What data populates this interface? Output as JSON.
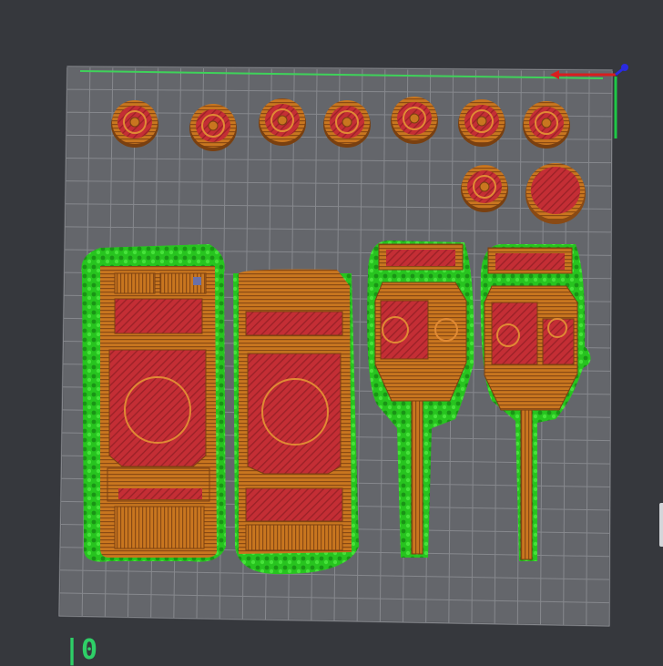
{
  "viewport": {
    "background_color": "#36383d",
    "plate_color": "#64666b",
    "grid_color": "#8d8f94",
    "colors": {
      "perimeter": "#c9761f",
      "perimeter_dark": "#7a4010",
      "infill": "#c42e35",
      "support": "#27c41f",
      "axis_x": "#d81e1e",
      "axis_y": "#1ec846",
      "axis_z": "#2a2ae0"
    }
  },
  "status": {
    "layer_label": "|0"
  },
  "objects": {
    "wheels_count": 9,
    "discs_count": 1,
    "hulls_count": 2,
    "turrets_count": 2
  }
}
